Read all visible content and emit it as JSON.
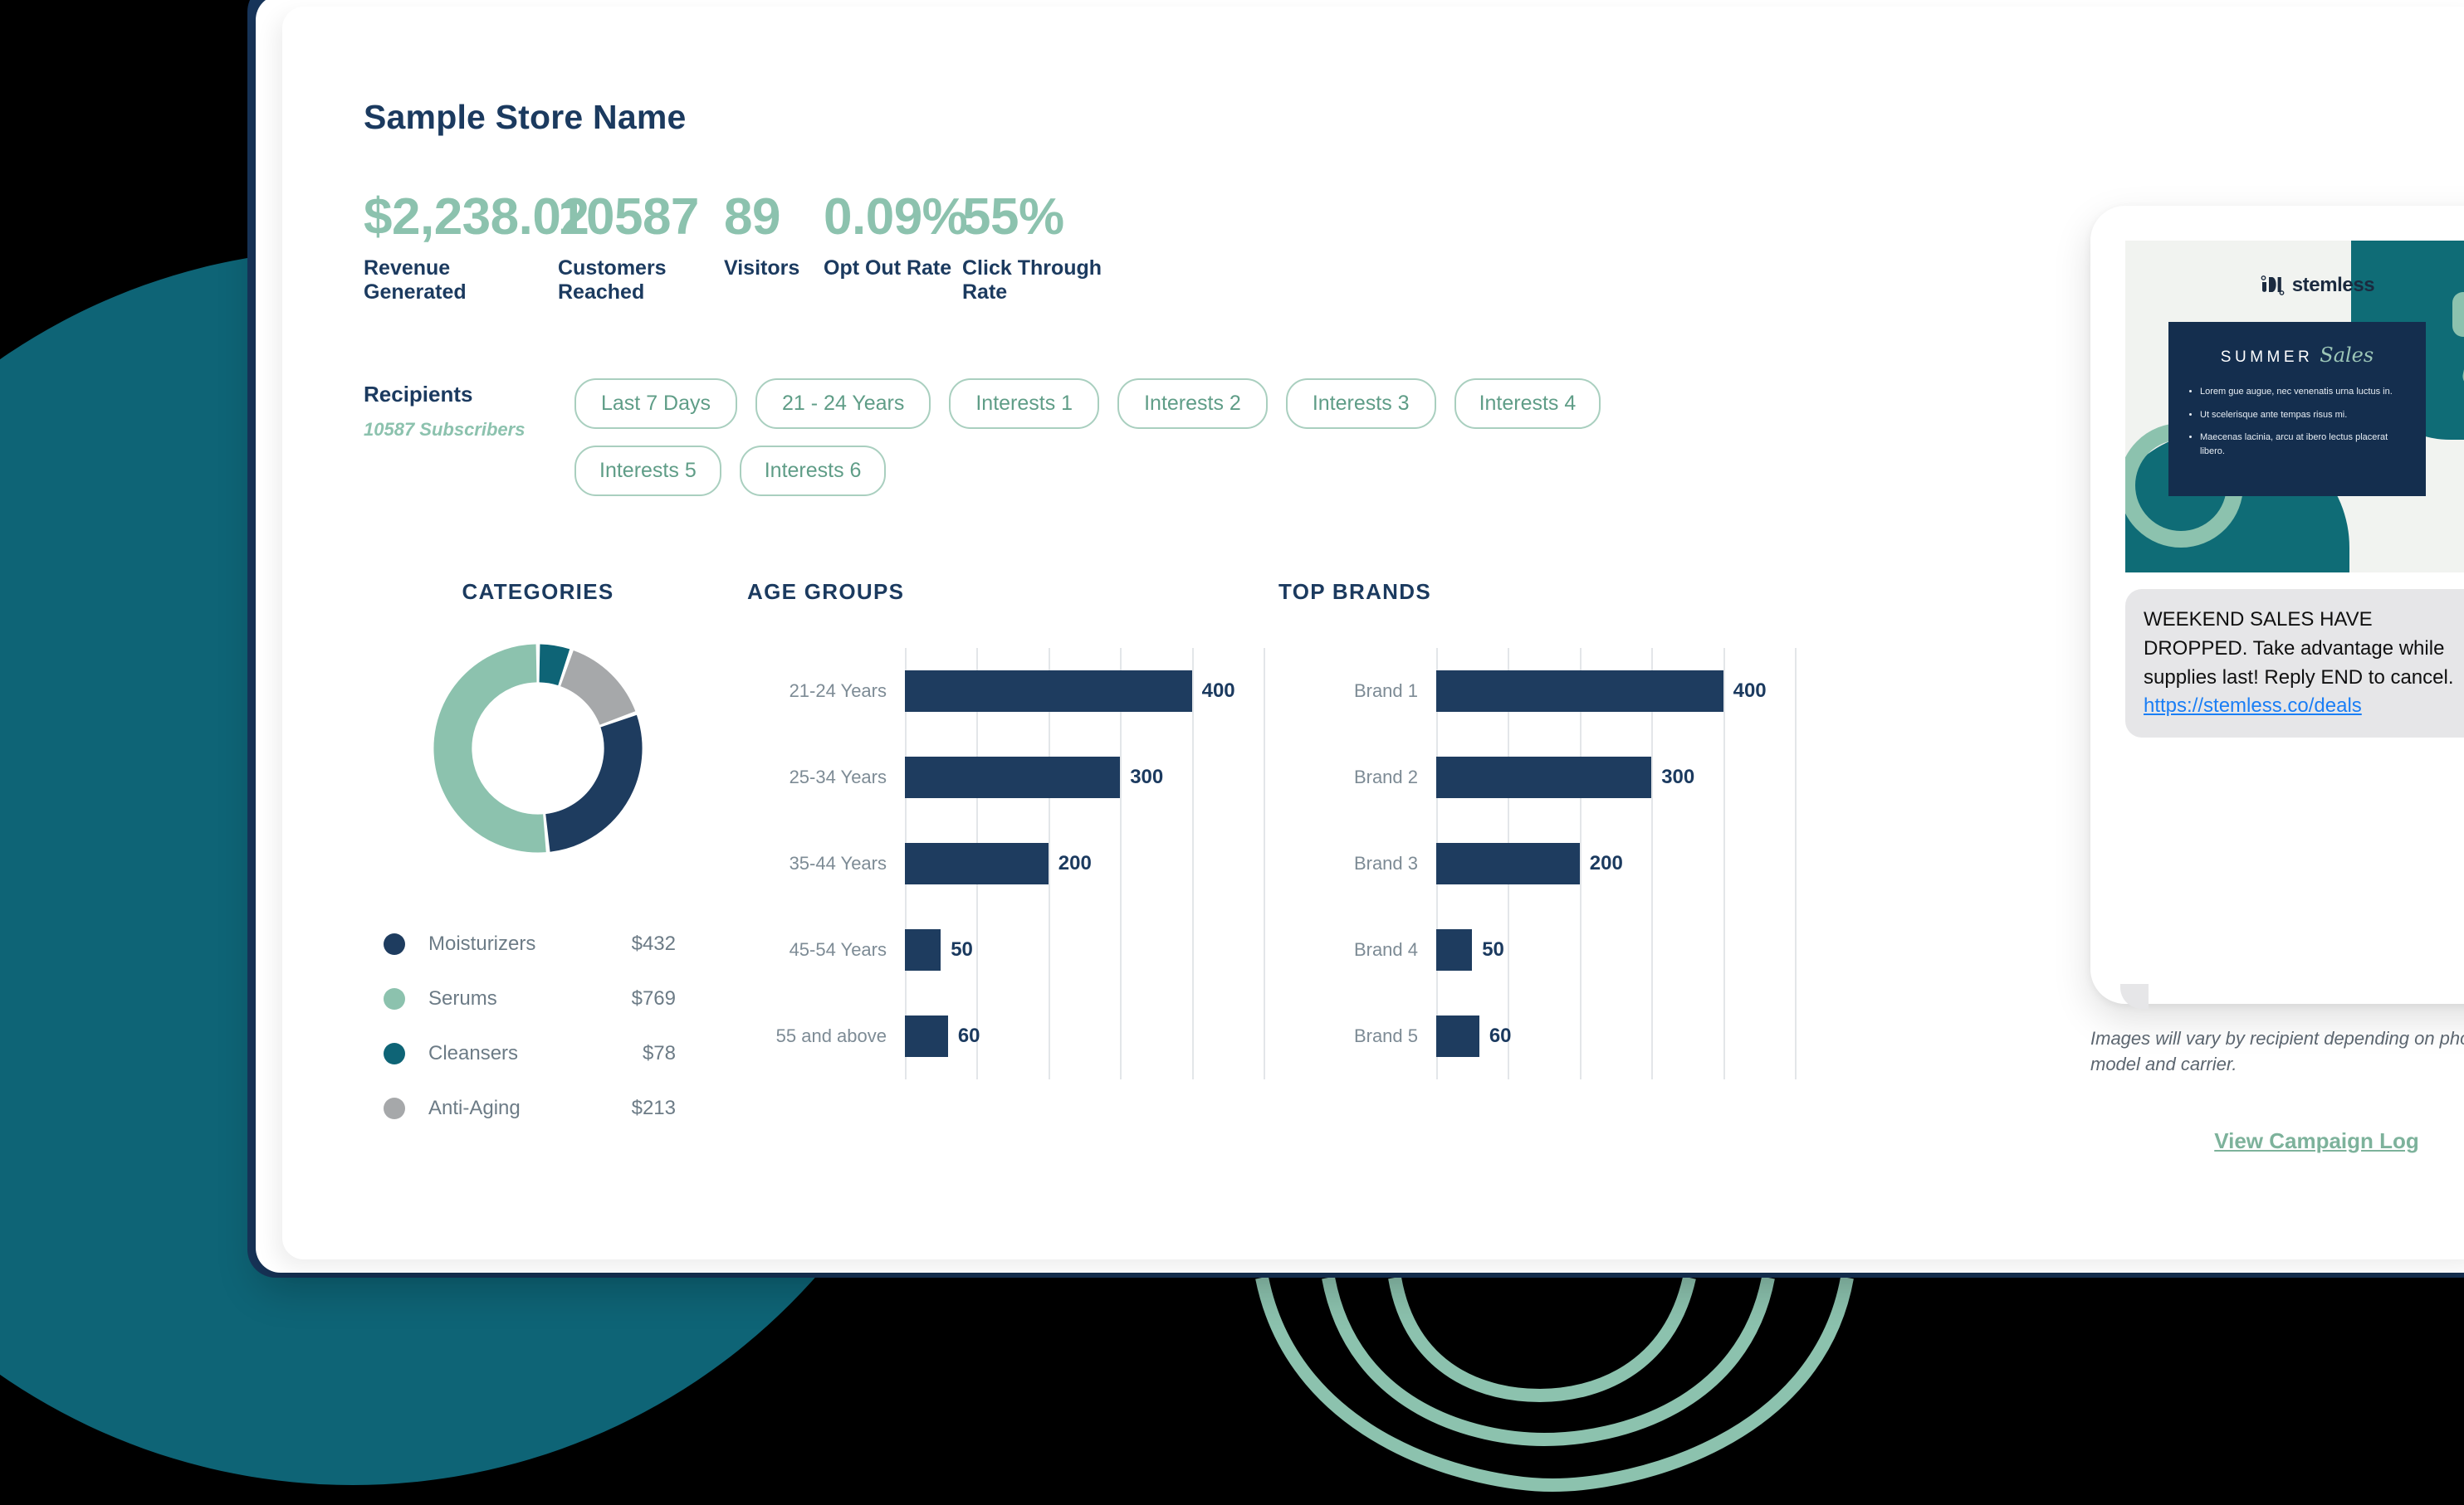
{
  "background": {
    "page_color": "#000000",
    "circle_color": "#0e6476",
    "arc_color": "#8cc2ae",
    "frame_color": "#18365c"
  },
  "header": {
    "store_name": "Sample Store Name"
  },
  "metrics": [
    {
      "value": "$2,238.02",
      "label": "Revenue Generated"
    },
    {
      "value": "10587",
      "label": "Customers Reached"
    },
    {
      "value": "89",
      "label": "Visitors"
    },
    {
      "value": "0.09%",
      "label": "Opt Out Rate"
    },
    {
      "value": "55%",
      "label": "Click Through Rate"
    }
  ],
  "recipients": {
    "title": "Recipients",
    "subtitle": "10587 Subscribers",
    "chips": [
      "Last 7 Days",
      "21 - 24 Years",
      "Interests 1",
      "Interests 2",
      "Interests 3",
      "Interests 4",
      "Interests 5",
      "Interests 6"
    ]
  },
  "chart_data": [
    {
      "type": "pie",
      "title": "CATEGORIES",
      "legend_position": "bottom",
      "categories": [
        "Moisturizers",
        "Serums",
        "Cleansers",
        "Anti-Aging"
      ],
      "values": [
        432,
        769,
        78,
        213
      ],
      "value_labels": [
        "$432",
        "$769",
        "$78",
        "$213"
      ],
      "colors": [
        "#1e3c5f",
        "#8cc2ae",
        "#0e6476",
        "#a6a8aa"
      ]
    },
    {
      "type": "bar",
      "title": "AGE GROUPS",
      "orientation": "horizontal",
      "categories": [
        "21-24 Years",
        "25-34 Years",
        "35-44 Years",
        "45-54 Years",
        "55 and above"
      ],
      "values": [
        400,
        300,
        200,
        50,
        60
      ],
      "xlabel": "",
      "ylabel": "",
      "xlim": [
        0,
        500
      ],
      "grid": true,
      "gridlines": 6,
      "bar_color": "#1e3c5f"
    },
    {
      "type": "bar",
      "title": "TOP BRANDS",
      "orientation": "horizontal",
      "categories": [
        "Brand 1",
        "Brand 2",
        "Brand 3",
        "Brand 4",
        "Brand 5"
      ],
      "values": [
        400,
        300,
        200,
        50,
        60
      ],
      "xlabel": "",
      "ylabel": "",
      "xlim": [
        0,
        500
      ],
      "grid": true,
      "gridlines": 6,
      "bar_color": "#1e3c5f"
    }
  ],
  "preview": {
    "logo_text": "stemless",
    "promo_heading_1": "SUMMER",
    "promo_heading_2": "Sales",
    "promo_bullets": [
      "Lorem gue augue, nec venenatis urna luctus in.",
      "Ut scelerisque ante tempas risus mi.",
      "Maecenas lacinia, arcu at ibero lectus placerat libero."
    ],
    "sms_text": "WEEKEND SALES HAVE DROPPED. Take advantage while supplies last! Reply END to cancel. ",
    "sms_link": "https://stemless.co/deals",
    "disclaimer": "Images will vary by recipient depending on phone model and carrier.",
    "campaign_log_label": "View Campaign Log"
  }
}
